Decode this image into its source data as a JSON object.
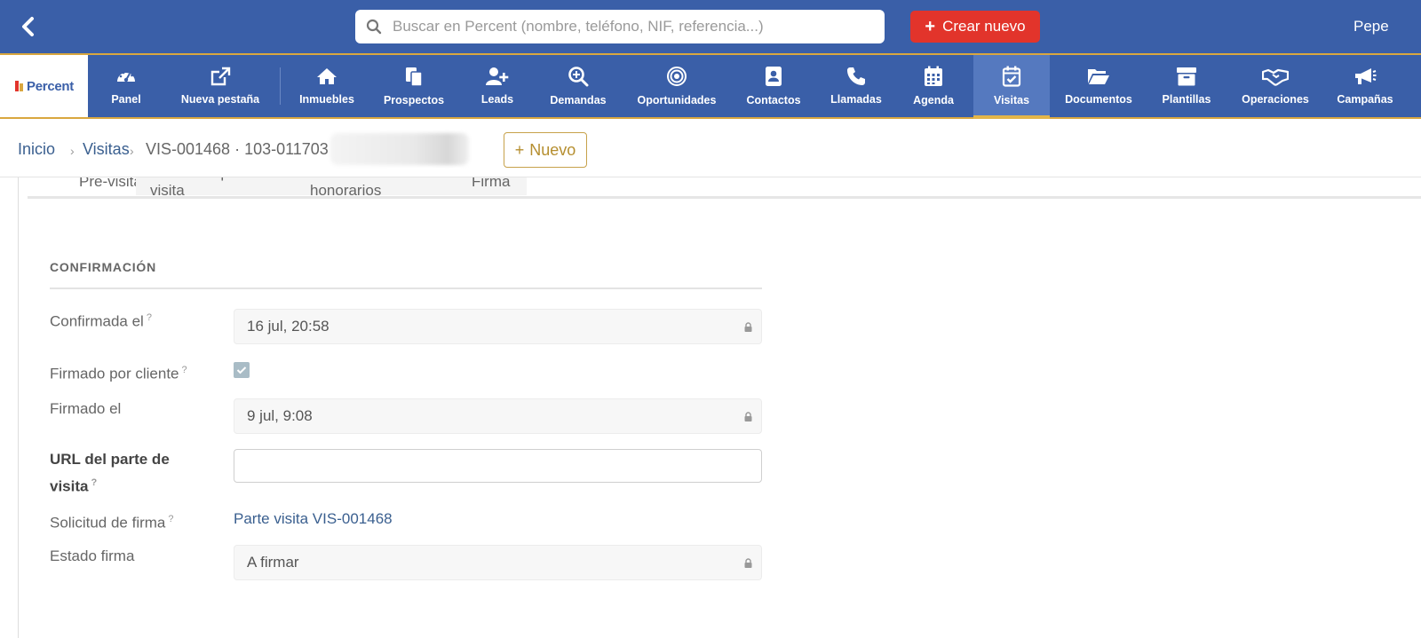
{
  "search": {
    "placeholder": "Buscar en Percent (nombre, teléfono, NIF, referencia...)"
  },
  "header": {
    "create_label": "Crear nuevo",
    "user": "Pepe"
  },
  "brand": {
    "logo_text": "Percent",
    "primary_color": "#3a5fa8",
    "accent_color": "#d9a73f",
    "create_color": "#e2342b"
  },
  "nav": {
    "items": [
      {
        "label": "Panel",
        "icon": "dashboard-icon"
      },
      {
        "label": "Nueva pestaña",
        "icon": "external-link-icon"
      },
      {
        "label": "Inmuebles",
        "icon": "home-icon"
      },
      {
        "label": "Prospectos",
        "icon": "documents-icon"
      },
      {
        "label": "Leads",
        "icon": "user-plus-icon"
      },
      {
        "label": "Demandas",
        "icon": "search-plus-icon"
      },
      {
        "label": "Oportunidades",
        "icon": "target-icon"
      },
      {
        "label": "Contactos",
        "icon": "contact-book-icon"
      },
      {
        "label": "Llamadas",
        "icon": "phone-icon"
      },
      {
        "label": "Agenda",
        "icon": "calendar-icon"
      },
      {
        "label": "Visitas",
        "icon": "calendar-check-icon",
        "active": true
      },
      {
        "label": "Documentos",
        "icon": "folder-open-icon"
      },
      {
        "label": "Plantillas",
        "icon": "archive-icon"
      },
      {
        "label": "Operaciones",
        "icon": "handshake-icon"
      },
      {
        "label": "Campañas",
        "icon": "megaphone-icon"
      }
    ]
  },
  "breadcrumb": {
    "home": "Inicio",
    "section": "Visitas",
    "current": "VIS-001468 · 103-011703 · (",
    "new_label": "Nuevo"
  },
  "tabs": [
    "Pre-visita",
    "Feedback post-visita",
    "Previsión honorarios",
    "Firma"
  ],
  "section": {
    "title": "CONFIRMACIÓN",
    "fields": {
      "confirmada_el": {
        "label": "Confirmada el",
        "help": "?",
        "value": "16 jul, 20:58"
      },
      "firmado_por_cliente": {
        "label": "Firmado por cliente",
        "help": "?",
        "checked": true
      },
      "firmado_el": {
        "label": "Firmado el",
        "value": "9 jul, 9:08"
      },
      "url_parte": {
        "label_line1": "URL del parte de",
        "label_line2": "visita",
        "help": "?",
        "value": ""
      },
      "solicitud_firma": {
        "label": "Solicitud de firma",
        "help": "?",
        "value": "Parte visita VIS-001468"
      },
      "estado_firma": {
        "label": "Estado firma",
        "value": "A firmar"
      }
    }
  }
}
